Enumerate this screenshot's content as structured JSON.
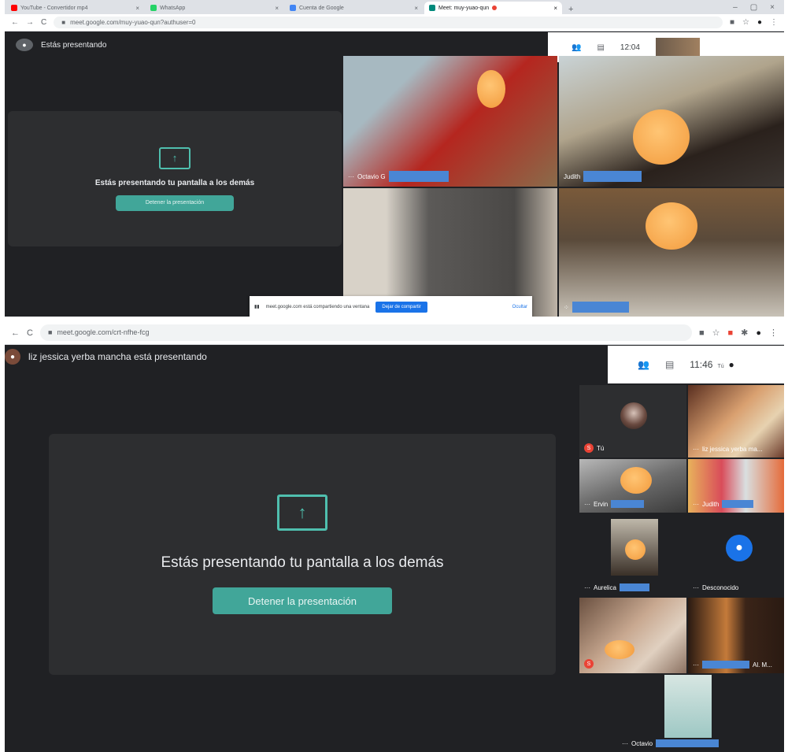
{
  "top": {
    "browser": {
      "tabs": [
        {
          "title": "YouTube - Convertidor mp4",
          "color": "#ff0000",
          "active": false
        },
        {
          "title": "WhatsApp",
          "color": "#25d366",
          "active": false
        },
        {
          "title": "Cuenta de Google",
          "color": "#4285f4",
          "active": false
        },
        {
          "title": "Meet: muy-yuao-qun",
          "color": "#00897b",
          "active": true
        }
      ],
      "url": "meet.google.com/muy-yuao-qun?authuser=0",
      "nav_back": "←",
      "nav_forward": "→",
      "reload": "C"
    },
    "presenting_label": "Estás presentando",
    "panel_text": "Estás presentando tu pantalla a los demás",
    "stop_label": "Detener la presentación",
    "clock": "12:04",
    "participants": [
      {
        "name": "Octavio G",
        "colors": [
          "#b5261f",
          "#8a6b4a"
        ]
      },
      {
        "name": "Judith",
        "colors": [
          "#c9d3d6",
          "#2a211c"
        ]
      },
      {
        "name": "",
        "colors": [
          "#5c5a58",
          "#d8d2c8"
        ]
      },
      {
        "name": "",
        "colors": [
          "#7a5a3a",
          "#c9c3b8"
        ]
      }
    ],
    "share_bar": {
      "text": "meet.google.com está compartiendo una ventana",
      "stop": "Dejar de compartir",
      "hide": "Ocultar"
    }
  },
  "bottom": {
    "browser": {
      "url": "meet.google.com/crt-nfhe-fcg",
      "nav_back": "←",
      "reload": "C"
    },
    "presenting_label": "liz jessica yerba mancha está presentando",
    "panel_text": "Estás presentando tu pantalla a los demás",
    "stop_label": "Detener la presentación",
    "clock": "11:46",
    "self_label": "Tú",
    "participants": [
      {
        "name": "Tú",
        "muted": true,
        "kind": "avatar",
        "colors": [
          "#202124",
          "#202124"
        ]
      },
      {
        "name": "liz jessica yerba ma...",
        "kind": "video",
        "colors": [
          "#6b3a2a",
          "#d9a070"
        ]
      },
      {
        "name": "Ervin",
        "kind": "video",
        "colors": [
          "#6c6c6c",
          "#caa37a"
        ]
      },
      {
        "name": "Judith",
        "kind": "video",
        "colors": [
          "#d94c5a",
          "#e8b25b"
        ]
      },
      {
        "name": "Aurelica",
        "kind": "video",
        "colors": [
          "#bfb8aa",
          "#3a3028"
        ]
      },
      {
        "name": "Desconocido",
        "kind": "placeholder",
        "colors": [
          "#202124",
          "#202124"
        ]
      },
      {
        "name": "",
        "muted": true,
        "kind": "video",
        "colors": [
          "#c8a890",
          "#6a5040"
        ]
      },
      {
        "name": "Al. M...",
        "kind": "video",
        "colors": [
          "#2a1a12",
          "#c47a3a"
        ]
      },
      {
        "name": "Octavio",
        "kind": "video",
        "colors": [
          "#9ec8c4",
          "#d7e6e2"
        ]
      }
    ]
  }
}
